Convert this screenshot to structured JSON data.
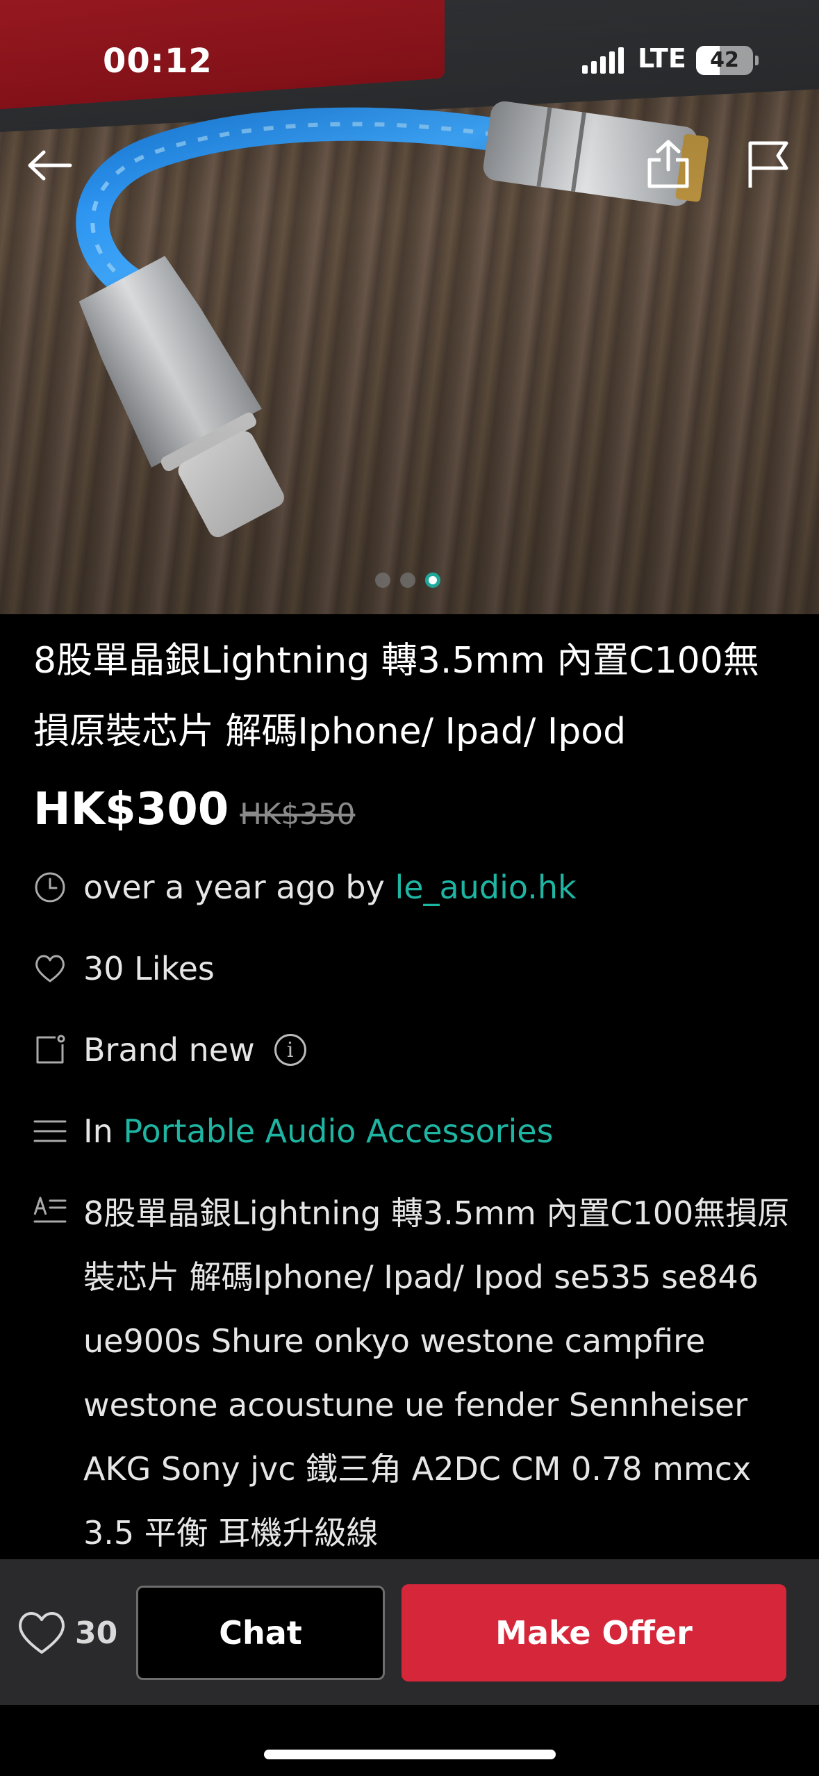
{
  "status_bar": {
    "time": "00:12",
    "network": "LTE",
    "battery": "42",
    "battery_level": 0.42
  },
  "hero": {
    "image_count": 3,
    "active_index": 2
  },
  "listing": {
    "title": "8股單晶銀Lightning 轉3.5mm 內置C100無損原裝芯片 解碼Iphone/ Ipad/ Ipod",
    "price": "HK$300",
    "original_price": "HK$350",
    "posted_text": "over a year ago by ",
    "seller": "le_audio.hk",
    "likes_text": "30 Likes",
    "condition": "Brand new",
    "info_glyph": "i",
    "category_prefix": "In ",
    "category": "Portable Audio Accessories",
    "description": "8股單晶銀Lightning 轉3.5mm 內置C100無損原裝芯片 解碼Iphone/ Ipad/ Ipod  se535 se846 ue900s Shure onkyo westone campfire westone acoustune ue fender Sennheiser AKG Sony jvc 鐵三角 A2DC CM 0.78 mmcx 3.5 平衡 耳機升級線"
  },
  "actions": {
    "like_count": "30",
    "chat_label": "Chat",
    "offer_label": "Make Offer"
  },
  "colors": {
    "accent_teal": "#1fb5a3",
    "offer_red": "#d6263a",
    "bar_bg": "#2a2a2c"
  },
  "icons": {
    "back": "arrow-left-icon",
    "share": "share-icon",
    "flag": "flag-icon",
    "time": "clock-icon",
    "likes": "heart-outline-icon",
    "condition": "tag-icon",
    "category": "list-icon",
    "description": "text-icon",
    "info": "info-icon"
  }
}
